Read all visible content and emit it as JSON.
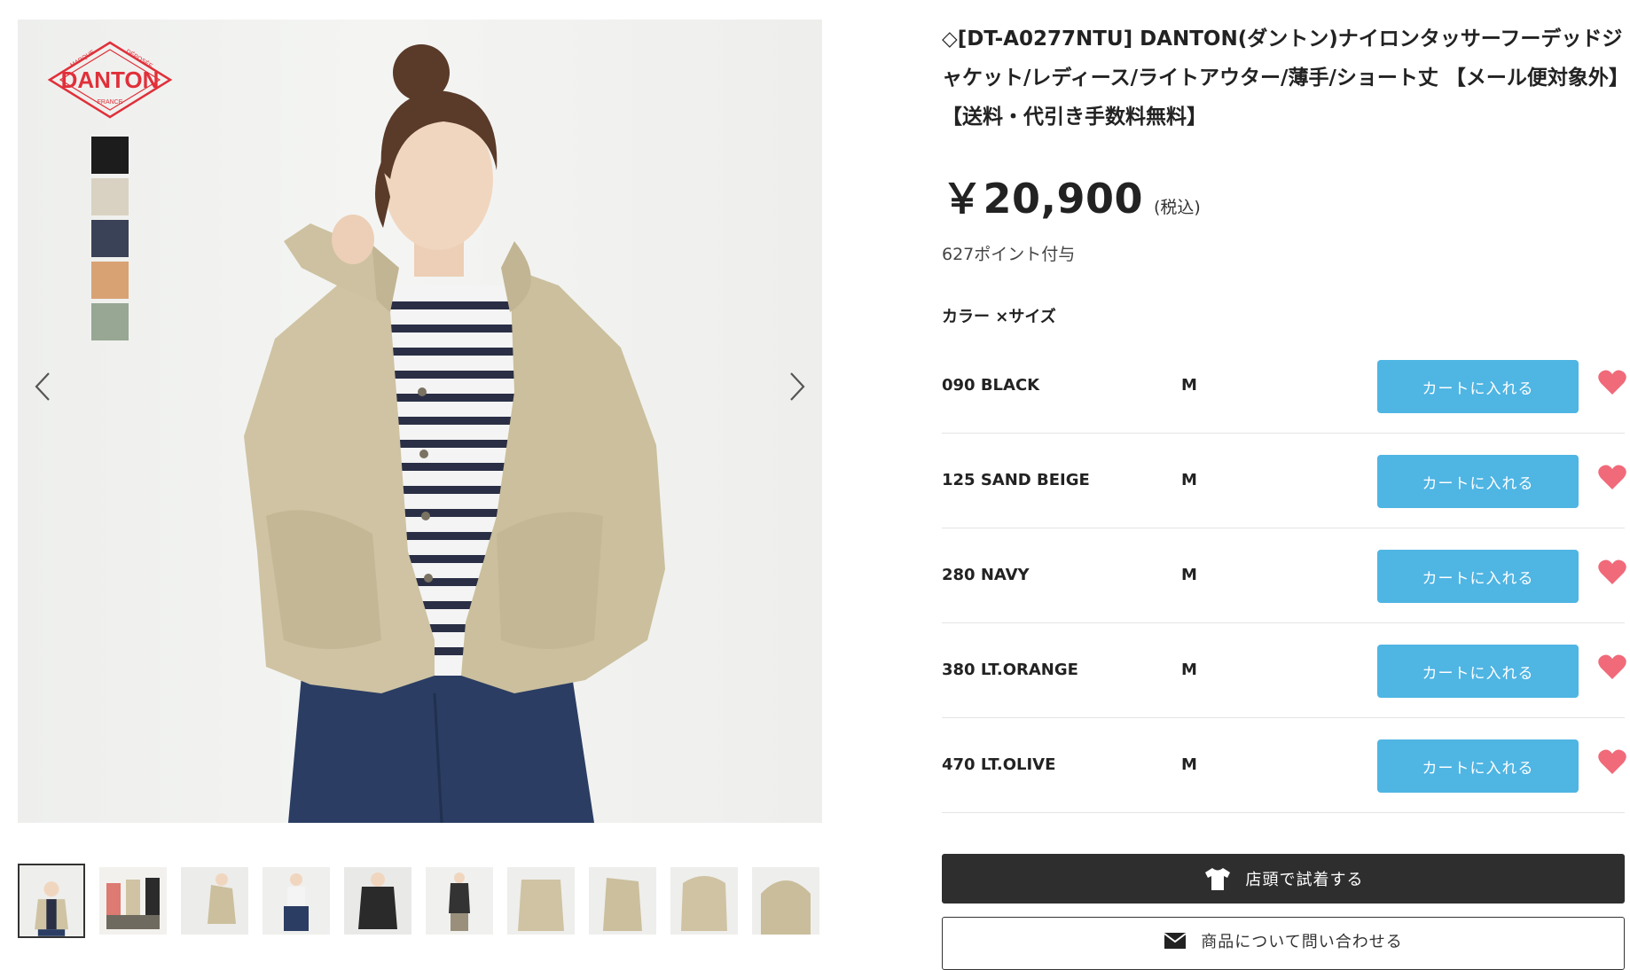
{
  "product": {
    "title": "◇[DT-A0277NTU] DANTON(ダントン)ナイロンタッサーフーデッドジャケット/レディース/ライトアウター/薄手/ショート丈 【メール便対象外】【送料・代引き手数料無料】",
    "price": "￥20,900",
    "tax_note": "(税込)",
    "points": "627ポイント付与",
    "variant_label": "カラー ×サイズ"
  },
  "gallery": {
    "brand_logo": {
      "text": "DANTON",
      "arc_top_left": "MARQUE",
      "arc_top_right": "DÉPOSÉE",
      "arc_bottom": "FRANCE",
      "color": "#e0303a"
    },
    "swatches": [
      "#1c1c1c",
      "#d9d2c2",
      "#3a4257",
      "#d9a273",
      "#97a794"
    ],
    "prev_icon": "chevron-left-icon",
    "next_icon": "chevron-right-icon",
    "thumbnail_count": 10
  },
  "variants": [
    {
      "color": "090 BLACK",
      "size": "M",
      "cart_label": "カートに入れる"
    },
    {
      "color": "125 SAND BEIGE",
      "size": "M",
      "cart_label": "カートに入れる"
    },
    {
      "color": "280 NAVY",
      "size": "M",
      "cart_label": "カートに入れる"
    },
    {
      "color": "380 LT.ORANGE",
      "size": "M",
      "cart_label": "カートに入れる"
    },
    {
      "color": "470 LT.OLIVE",
      "size": "M",
      "cart_label": "カートに入れる"
    }
  ],
  "actions": {
    "try_on_label": "店頭で試着する",
    "try_on_icon": "tshirt-icon",
    "inquiry_label": "商品について問い合わせる",
    "inquiry_icon": "envelope-icon"
  },
  "colors": {
    "cart_button": "#4fb5e3",
    "favorite_heart": "#f06a7a",
    "try_on_button": "#2e2e2e"
  }
}
